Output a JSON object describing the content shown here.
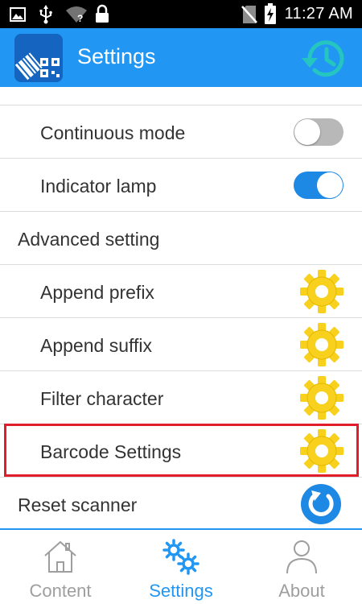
{
  "status_bar": {
    "time": "11:27 AM"
  },
  "app_bar": {
    "title": "Settings",
    "history_icon": "history-icon",
    "logo_icon": "barcode-logo-icon"
  },
  "settings": {
    "continuous_mode": {
      "label": "Continuous mode",
      "enabled": false
    },
    "indicator_lamp": {
      "label": "Indicator lamp",
      "enabled": true
    },
    "advanced_header": "Advanced setting",
    "append_prefix": "Append prefix",
    "append_suffix": "Append suffix",
    "filter_character": "Filter character",
    "barcode_settings": "Barcode Settings",
    "reset_scanner": "Reset scanner"
  },
  "bottom_nav": {
    "items": [
      {
        "label": "Content",
        "icon": "home-icon",
        "active": false
      },
      {
        "label": "Settings",
        "icon": "gears-icon",
        "active": true
      },
      {
        "label": "About",
        "icon": "person-icon",
        "active": false
      }
    ]
  },
  "colors": {
    "primary": "#2196f3",
    "switch_on": "#1e88e5",
    "switch_off": "#b8b8b8",
    "gear": "#f7d11e",
    "highlight": "#e11d2a",
    "nav_inactive": "#9e9e9e"
  }
}
